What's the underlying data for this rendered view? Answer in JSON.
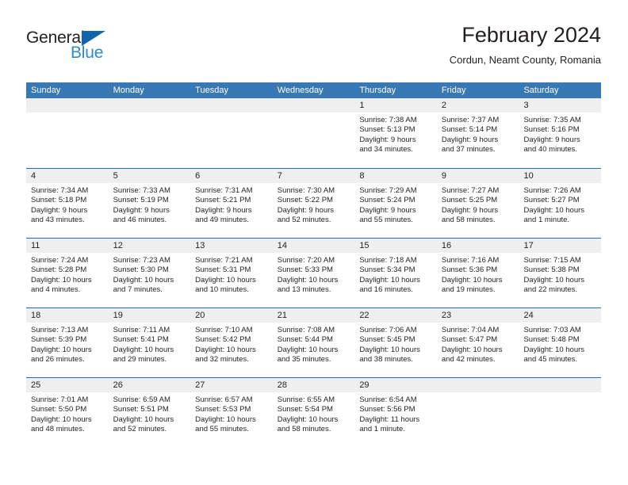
{
  "brand": {
    "name_part1": "General",
    "name_part2": "Blue",
    "accent_color": "#2e8bd0",
    "triangle_color": "#1265ab"
  },
  "header": {
    "title": "February 2024",
    "subtitle": "Cordun, Neamt County, Romania"
  },
  "theme": {
    "header_row_bg": "#3878b4",
    "row_divider": "#2a6aa8",
    "day_band_bg": "#efefef",
    "text_color": "#231f20"
  },
  "calendar": {
    "weekdays": [
      "Sunday",
      "Monday",
      "Tuesday",
      "Wednesday",
      "Thursday",
      "Friday",
      "Saturday"
    ],
    "weeks": [
      [
        {
          "day": "",
          "empty": true
        },
        {
          "day": "",
          "empty": true
        },
        {
          "day": "",
          "empty": true
        },
        {
          "day": "",
          "empty": true
        },
        {
          "day": "1",
          "sunrise": "Sunrise: 7:38 AM",
          "sunset": "Sunset: 5:13 PM",
          "daylight_line1": "Daylight: 9 hours",
          "daylight_line2": "and 34 minutes."
        },
        {
          "day": "2",
          "sunrise": "Sunrise: 7:37 AM",
          "sunset": "Sunset: 5:14 PM",
          "daylight_line1": "Daylight: 9 hours",
          "daylight_line2": "and 37 minutes."
        },
        {
          "day": "3",
          "sunrise": "Sunrise: 7:35 AM",
          "sunset": "Sunset: 5:16 PM",
          "daylight_line1": "Daylight: 9 hours",
          "daylight_line2": "and 40 minutes."
        }
      ],
      [
        {
          "day": "4",
          "sunrise": "Sunrise: 7:34 AM",
          "sunset": "Sunset: 5:18 PM",
          "daylight_line1": "Daylight: 9 hours",
          "daylight_line2": "and 43 minutes."
        },
        {
          "day": "5",
          "sunrise": "Sunrise: 7:33 AM",
          "sunset": "Sunset: 5:19 PM",
          "daylight_line1": "Daylight: 9 hours",
          "daylight_line2": "and 46 minutes."
        },
        {
          "day": "6",
          "sunrise": "Sunrise: 7:31 AM",
          "sunset": "Sunset: 5:21 PM",
          "daylight_line1": "Daylight: 9 hours",
          "daylight_line2": "and 49 minutes."
        },
        {
          "day": "7",
          "sunrise": "Sunrise: 7:30 AM",
          "sunset": "Sunset: 5:22 PM",
          "daylight_line1": "Daylight: 9 hours",
          "daylight_line2": "and 52 minutes."
        },
        {
          "day": "8",
          "sunrise": "Sunrise: 7:29 AM",
          "sunset": "Sunset: 5:24 PM",
          "daylight_line1": "Daylight: 9 hours",
          "daylight_line2": "and 55 minutes."
        },
        {
          "day": "9",
          "sunrise": "Sunrise: 7:27 AM",
          "sunset": "Sunset: 5:25 PM",
          "daylight_line1": "Daylight: 9 hours",
          "daylight_line2": "and 58 minutes."
        },
        {
          "day": "10",
          "sunrise": "Sunrise: 7:26 AM",
          "sunset": "Sunset: 5:27 PM",
          "daylight_line1": "Daylight: 10 hours",
          "daylight_line2": "and 1 minute."
        }
      ],
      [
        {
          "day": "11",
          "sunrise": "Sunrise: 7:24 AM",
          "sunset": "Sunset: 5:28 PM",
          "daylight_line1": "Daylight: 10 hours",
          "daylight_line2": "and 4 minutes."
        },
        {
          "day": "12",
          "sunrise": "Sunrise: 7:23 AM",
          "sunset": "Sunset: 5:30 PM",
          "daylight_line1": "Daylight: 10 hours",
          "daylight_line2": "and 7 minutes."
        },
        {
          "day": "13",
          "sunrise": "Sunrise: 7:21 AM",
          "sunset": "Sunset: 5:31 PM",
          "daylight_line1": "Daylight: 10 hours",
          "daylight_line2": "and 10 minutes."
        },
        {
          "day": "14",
          "sunrise": "Sunrise: 7:20 AM",
          "sunset": "Sunset: 5:33 PM",
          "daylight_line1": "Daylight: 10 hours",
          "daylight_line2": "and 13 minutes."
        },
        {
          "day": "15",
          "sunrise": "Sunrise: 7:18 AM",
          "sunset": "Sunset: 5:34 PM",
          "daylight_line1": "Daylight: 10 hours",
          "daylight_line2": "and 16 minutes."
        },
        {
          "day": "16",
          "sunrise": "Sunrise: 7:16 AM",
          "sunset": "Sunset: 5:36 PM",
          "daylight_line1": "Daylight: 10 hours",
          "daylight_line2": "and 19 minutes."
        },
        {
          "day": "17",
          "sunrise": "Sunrise: 7:15 AM",
          "sunset": "Sunset: 5:38 PM",
          "daylight_line1": "Daylight: 10 hours",
          "daylight_line2": "and 22 minutes."
        }
      ],
      [
        {
          "day": "18",
          "sunrise": "Sunrise: 7:13 AM",
          "sunset": "Sunset: 5:39 PM",
          "daylight_line1": "Daylight: 10 hours",
          "daylight_line2": "and 26 minutes."
        },
        {
          "day": "19",
          "sunrise": "Sunrise: 7:11 AM",
          "sunset": "Sunset: 5:41 PM",
          "daylight_line1": "Daylight: 10 hours",
          "daylight_line2": "and 29 minutes."
        },
        {
          "day": "20",
          "sunrise": "Sunrise: 7:10 AM",
          "sunset": "Sunset: 5:42 PM",
          "daylight_line1": "Daylight: 10 hours",
          "daylight_line2": "and 32 minutes."
        },
        {
          "day": "21",
          "sunrise": "Sunrise: 7:08 AM",
          "sunset": "Sunset: 5:44 PM",
          "daylight_line1": "Daylight: 10 hours",
          "daylight_line2": "and 35 minutes."
        },
        {
          "day": "22",
          "sunrise": "Sunrise: 7:06 AM",
          "sunset": "Sunset: 5:45 PM",
          "daylight_line1": "Daylight: 10 hours",
          "daylight_line2": "and 38 minutes."
        },
        {
          "day": "23",
          "sunrise": "Sunrise: 7:04 AM",
          "sunset": "Sunset: 5:47 PM",
          "daylight_line1": "Daylight: 10 hours",
          "daylight_line2": "and 42 minutes."
        },
        {
          "day": "24",
          "sunrise": "Sunrise: 7:03 AM",
          "sunset": "Sunset: 5:48 PM",
          "daylight_line1": "Daylight: 10 hours",
          "daylight_line2": "and 45 minutes."
        }
      ],
      [
        {
          "day": "25",
          "sunrise": "Sunrise: 7:01 AM",
          "sunset": "Sunset: 5:50 PM",
          "daylight_line1": "Daylight: 10 hours",
          "daylight_line2": "and 48 minutes."
        },
        {
          "day": "26",
          "sunrise": "Sunrise: 6:59 AM",
          "sunset": "Sunset: 5:51 PM",
          "daylight_line1": "Daylight: 10 hours",
          "daylight_line2": "and 52 minutes."
        },
        {
          "day": "27",
          "sunrise": "Sunrise: 6:57 AM",
          "sunset": "Sunset: 5:53 PM",
          "daylight_line1": "Daylight: 10 hours",
          "daylight_line2": "and 55 minutes."
        },
        {
          "day": "28",
          "sunrise": "Sunrise: 6:55 AM",
          "sunset": "Sunset: 5:54 PM",
          "daylight_line1": "Daylight: 10 hours",
          "daylight_line2": "and 58 minutes."
        },
        {
          "day": "29",
          "sunrise": "Sunrise: 6:54 AM",
          "sunset": "Sunset: 5:56 PM",
          "daylight_line1": "Daylight: 11 hours",
          "daylight_line2": "and 1 minute."
        },
        {
          "day": "",
          "empty": true
        },
        {
          "day": "",
          "empty": true
        }
      ]
    ]
  }
}
